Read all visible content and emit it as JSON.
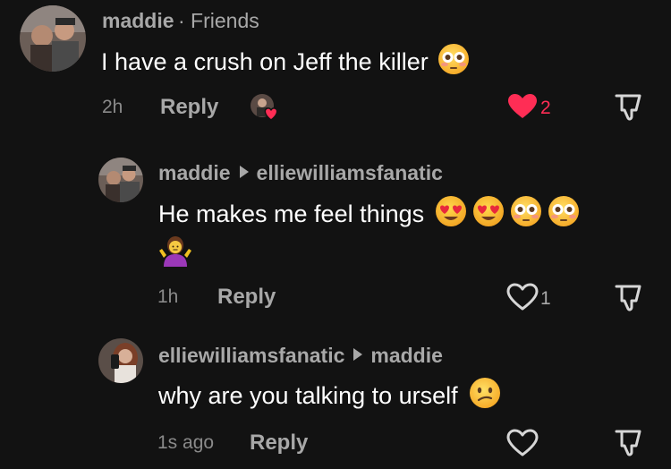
{
  "comments": [
    {
      "user": "maddie",
      "relation": "Friends",
      "text": "I have a crush on Jeff the killer",
      "time": "2h",
      "reply_label": "Reply",
      "likes": "2",
      "liked": true,
      "liked_by_creator": true
    },
    {
      "user": "maddie",
      "reply_to": "elliewilliamsfanatic",
      "text": "He makes me feel things",
      "time": "1h",
      "reply_label": "Reply",
      "likes": "1",
      "liked": false
    },
    {
      "user": "elliewilliamsfanatic",
      "reply_to": "maddie",
      "text": "why are you talking to urself",
      "time": "1s ago",
      "reply_label": "Reply",
      "likes": "",
      "liked": false
    }
  ],
  "colors": {
    "heart_active": "#ff2d55",
    "muted": "#a8a8a8",
    "background": "#121212"
  },
  "icons": [
    "heart-icon",
    "dislike-icon",
    "flushed-face-emoji",
    "heart-eyes-emoji",
    "shrug-emoji",
    "confused-face-emoji"
  ]
}
